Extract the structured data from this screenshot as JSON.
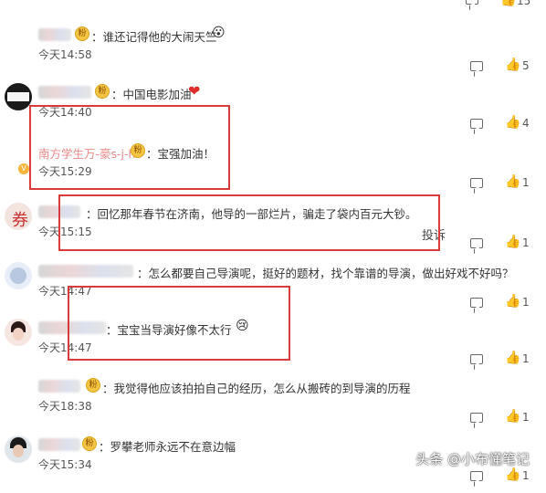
{
  "comments": [
    {
      "text": "：谁还记得他的大闹天竺",
      "emoji": "😮",
      "time": "今天14:58",
      "likes": "5"
    },
    {
      "text": "：中国电影加油",
      "emoji": "❤",
      "time": "今天14:40",
      "likes": "4"
    },
    {
      "name": "南方学生万-豪s-j-h",
      "text": "：宝强加油！",
      "time": "今天15:29",
      "likes": "1"
    },
    {
      "text": "：回忆那年春节在济南，他导的一部烂片，骗走了袋内百元大钞。",
      "time": "今天15:15",
      "likes": "1",
      "report": "投诉"
    },
    {
      "text": "：怎么都要自己导演呢，挺好的题材，找个靠谱的导演，做出好戏不好吗？",
      "time": "今天14:47",
      "likes": "1"
    },
    {
      "text": "：宝宝当导演好像不太行",
      "emoji": "😢",
      "time": "今天14:47",
      "likes": "1"
    },
    {
      "text": "：我觉得他应该拍拍自己的经历，怎么从搬砖的到导演的历程",
      "time": "今天18:38",
      "likes": "1"
    },
    {
      "text": "：罗攀老师永远不在意边幅",
      "time": "今天15:34",
      "likes": "1"
    }
  ],
  "top_partial_likes": "15",
  "watermark": "头条 @小布懂笔记",
  "colors": {
    "highlight_box": "#d93a3a",
    "badge": "#f4c542"
  }
}
